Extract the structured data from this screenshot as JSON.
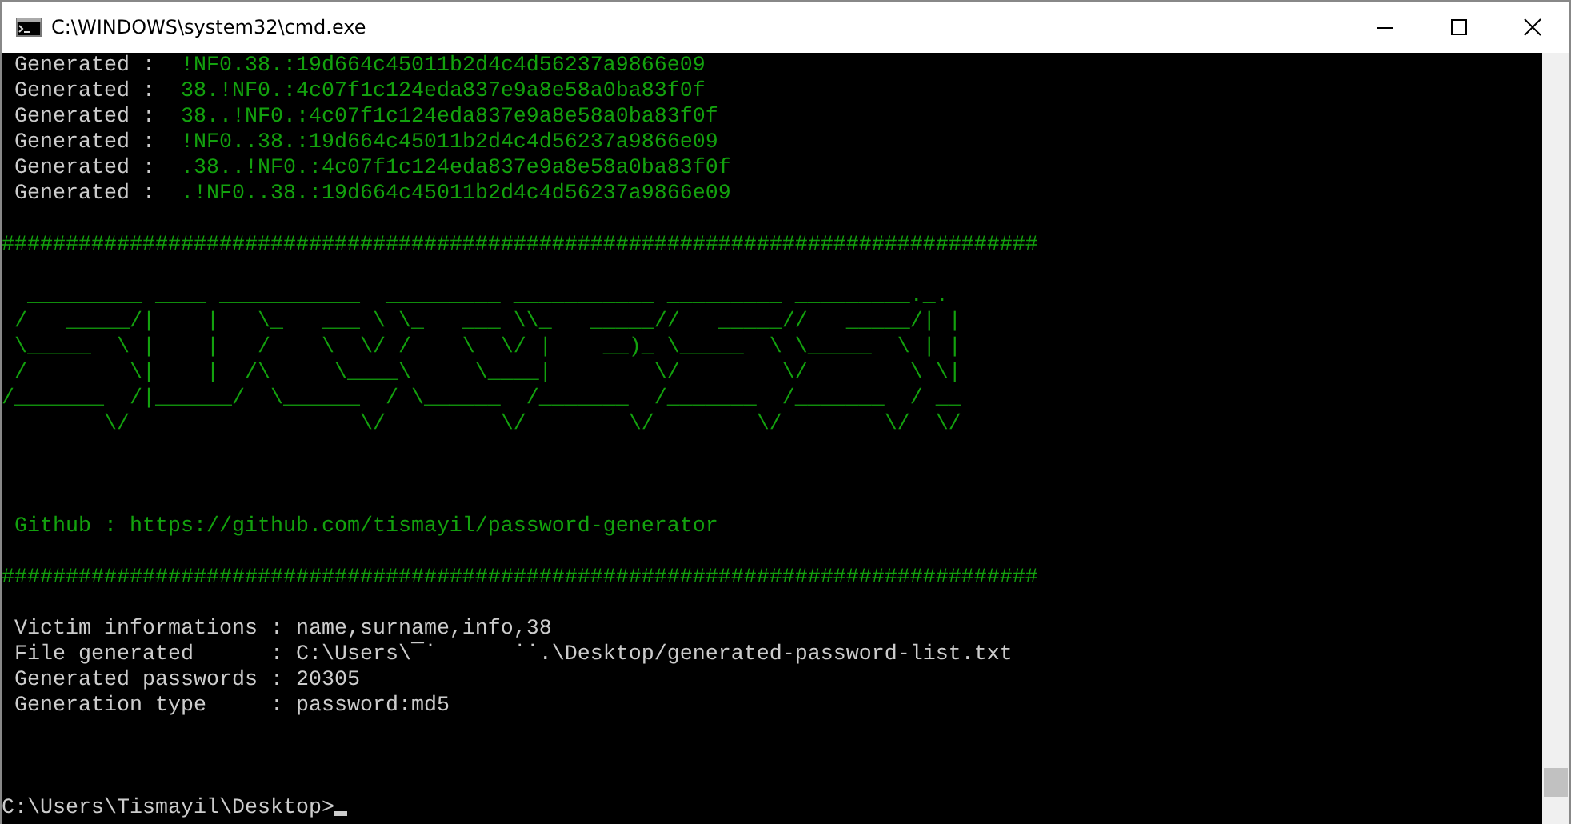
{
  "window": {
    "title": "C:\\WINDOWS\\system32\\cmd.exe"
  },
  "console": {
    "lines": [
      {
        "kind": "generated",
        "label": " Generated :  ",
        "value": "!NF0.38.:19d664c45011b2d4c4d56237a9866e09"
      },
      {
        "kind": "generated",
        "label": " Generated :  ",
        "value": "38.!NF0.:4c07f1c124eda837e9a8e58a0ba83f0f"
      },
      {
        "kind": "generated",
        "label": " Generated :  ",
        "value": "38..!NF0.:4c07f1c124eda837e9a8e58a0ba83f0f"
      },
      {
        "kind": "generated",
        "label": " Generated :  ",
        "value": "!NF0..38.:19d664c45011b2d4c4d56237a9866e09"
      },
      {
        "kind": "generated",
        "label": " Generated :  ",
        "value": ".38..!NF0.:4c07f1c124eda837e9a8e58a0ba83f0f"
      },
      {
        "kind": "generated",
        "label": " Generated :  ",
        "value": ".!NF0..38.:19d664c45011b2d4c4d56237a9866e09"
      },
      {
        "kind": "blank"
      },
      {
        "kind": "separator",
        "text": "#################################################################################"
      },
      {
        "kind": "blank"
      },
      {
        "kind": "banner",
        "lines": [
          "  _________ ____ ___________  _________ ___________ _________ _________._.",
          " /   _____/|    |   \\_   ___ \\ \\_   ___ \\\\_   _____//   _____//   _____/| |",
          " \\_____  \\ |    |   /    \\  \\/ /    \\  \\/ |    __)_ \\_____  \\ \\_____  \\ | |",
          " /        \\|    |  /\\     \\____\\     \\____|        \\/        \\/        \\ \\|",
          "/_______  /|______/  \\______  / \\______  /_______  /_______  /_______  / __",
          "        \\/                  \\/         \\/        \\/        \\/        \\/  \\/"
        ]
      },
      {
        "kind": "blank"
      },
      {
        "kind": "blank"
      },
      {
        "kind": "blank"
      },
      {
        "kind": "link",
        "text": " Github : https://github.com/tismayil/password-generator"
      },
      {
        "kind": "blank"
      },
      {
        "kind": "separator",
        "text": "#################################################################################"
      },
      {
        "kind": "blank"
      },
      {
        "kind": "info",
        "text": " Victim informations : name,surname,info,38"
      },
      {
        "kind": "info",
        "text": " File generated      : C:\\Users\\¯˙      ˙˙.\\Desktop/generated-password-list.txt"
      },
      {
        "kind": "info",
        "text": " Generated passwords : 20305"
      },
      {
        "kind": "info",
        "text": " Generation type     : password:md5"
      },
      {
        "kind": "blank"
      },
      {
        "kind": "blank"
      },
      {
        "kind": "blank"
      },
      {
        "kind": "prompt",
        "text": "C:\\Users\\Tismayil\\Desktop>"
      }
    ]
  }
}
